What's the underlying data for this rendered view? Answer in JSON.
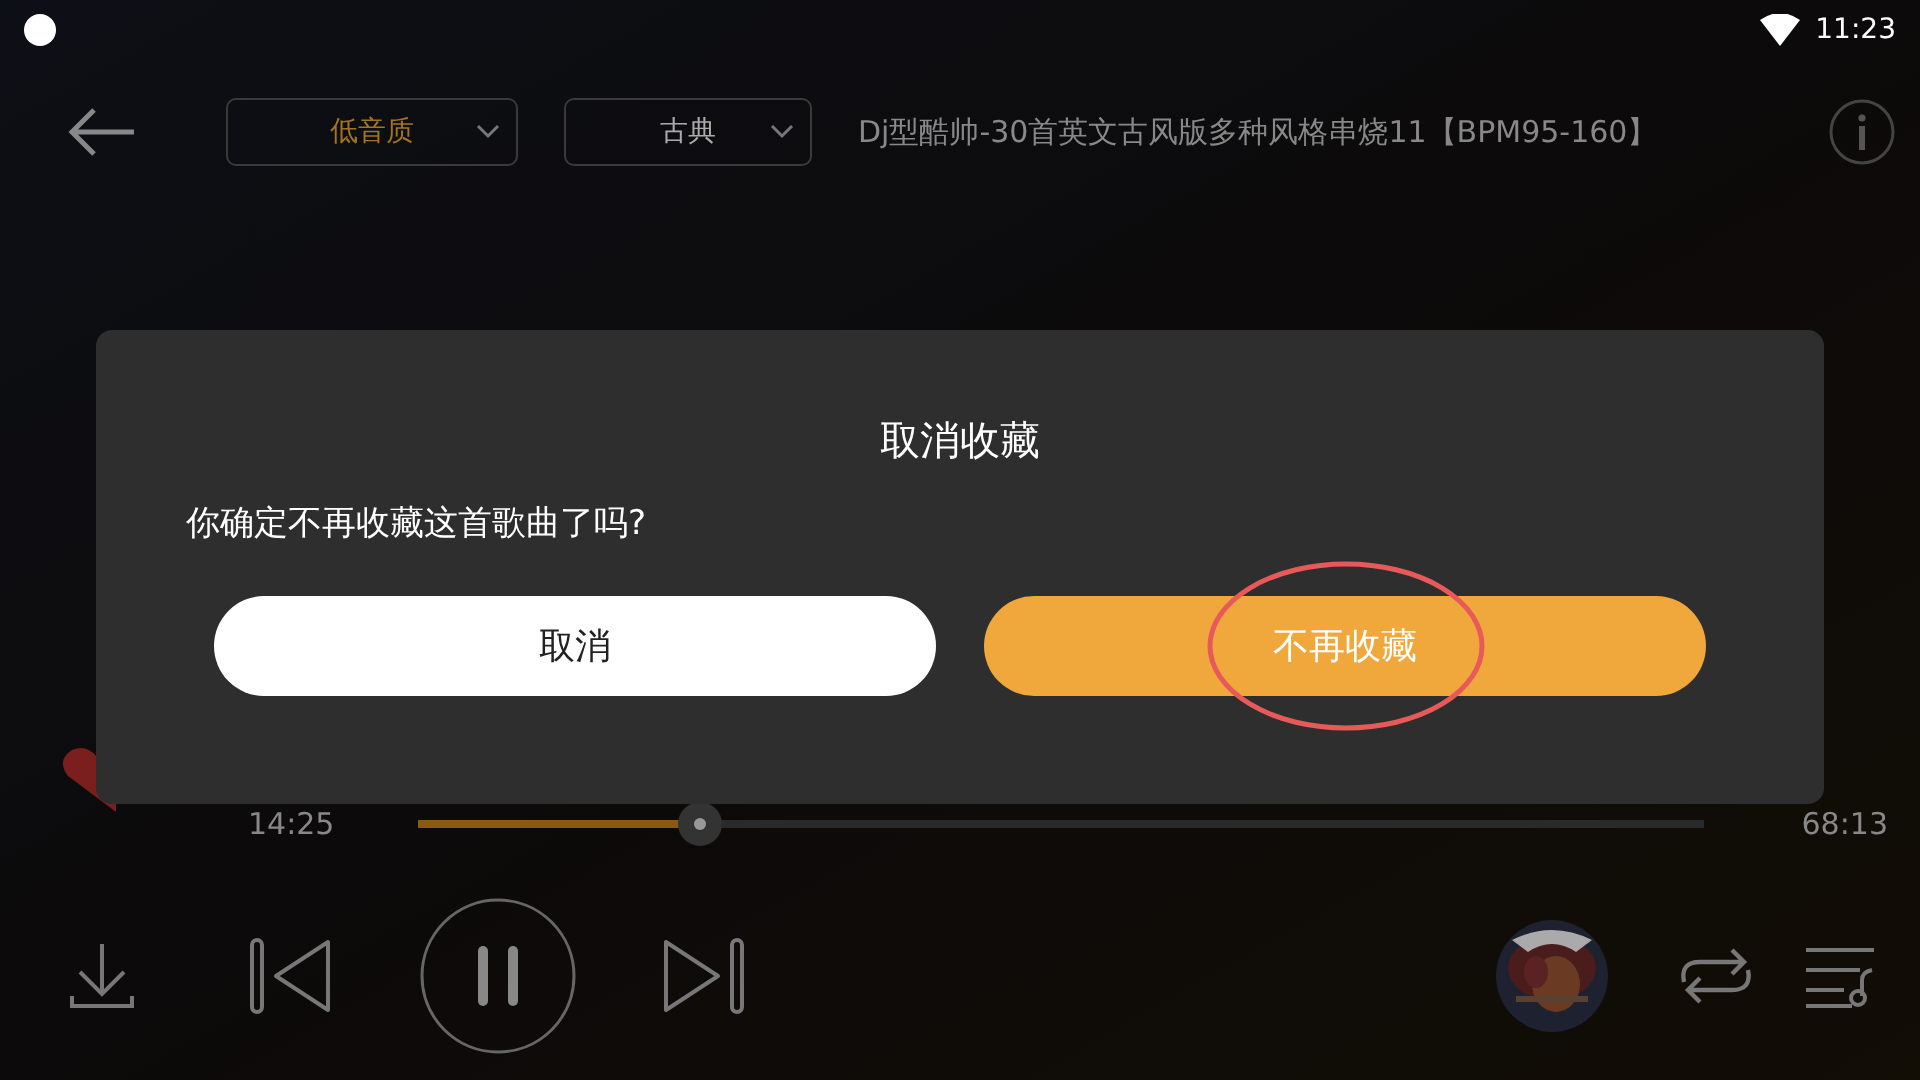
{
  "status_bar": {
    "time": "11:23"
  },
  "header": {
    "quality": "低音质",
    "genre": "古典",
    "title": "Dj型酷帅-30首英文古风版多种风格串烧11【BPM95-160】"
  },
  "player": {
    "favorite": true,
    "elapsed": "14:25",
    "total": "68:13",
    "level": 0.22
  },
  "dialog": {
    "title": "取消收藏",
    "message": "你确定不再收藏这首歌曲了吗?",
    "buttons": [
      {
        "label": "取消",
        "kind": "secondary"
      },
      {
        "label": "不再收藏",
        "kind": "primary",
        "circled": true
      }
    ]
  }
}
